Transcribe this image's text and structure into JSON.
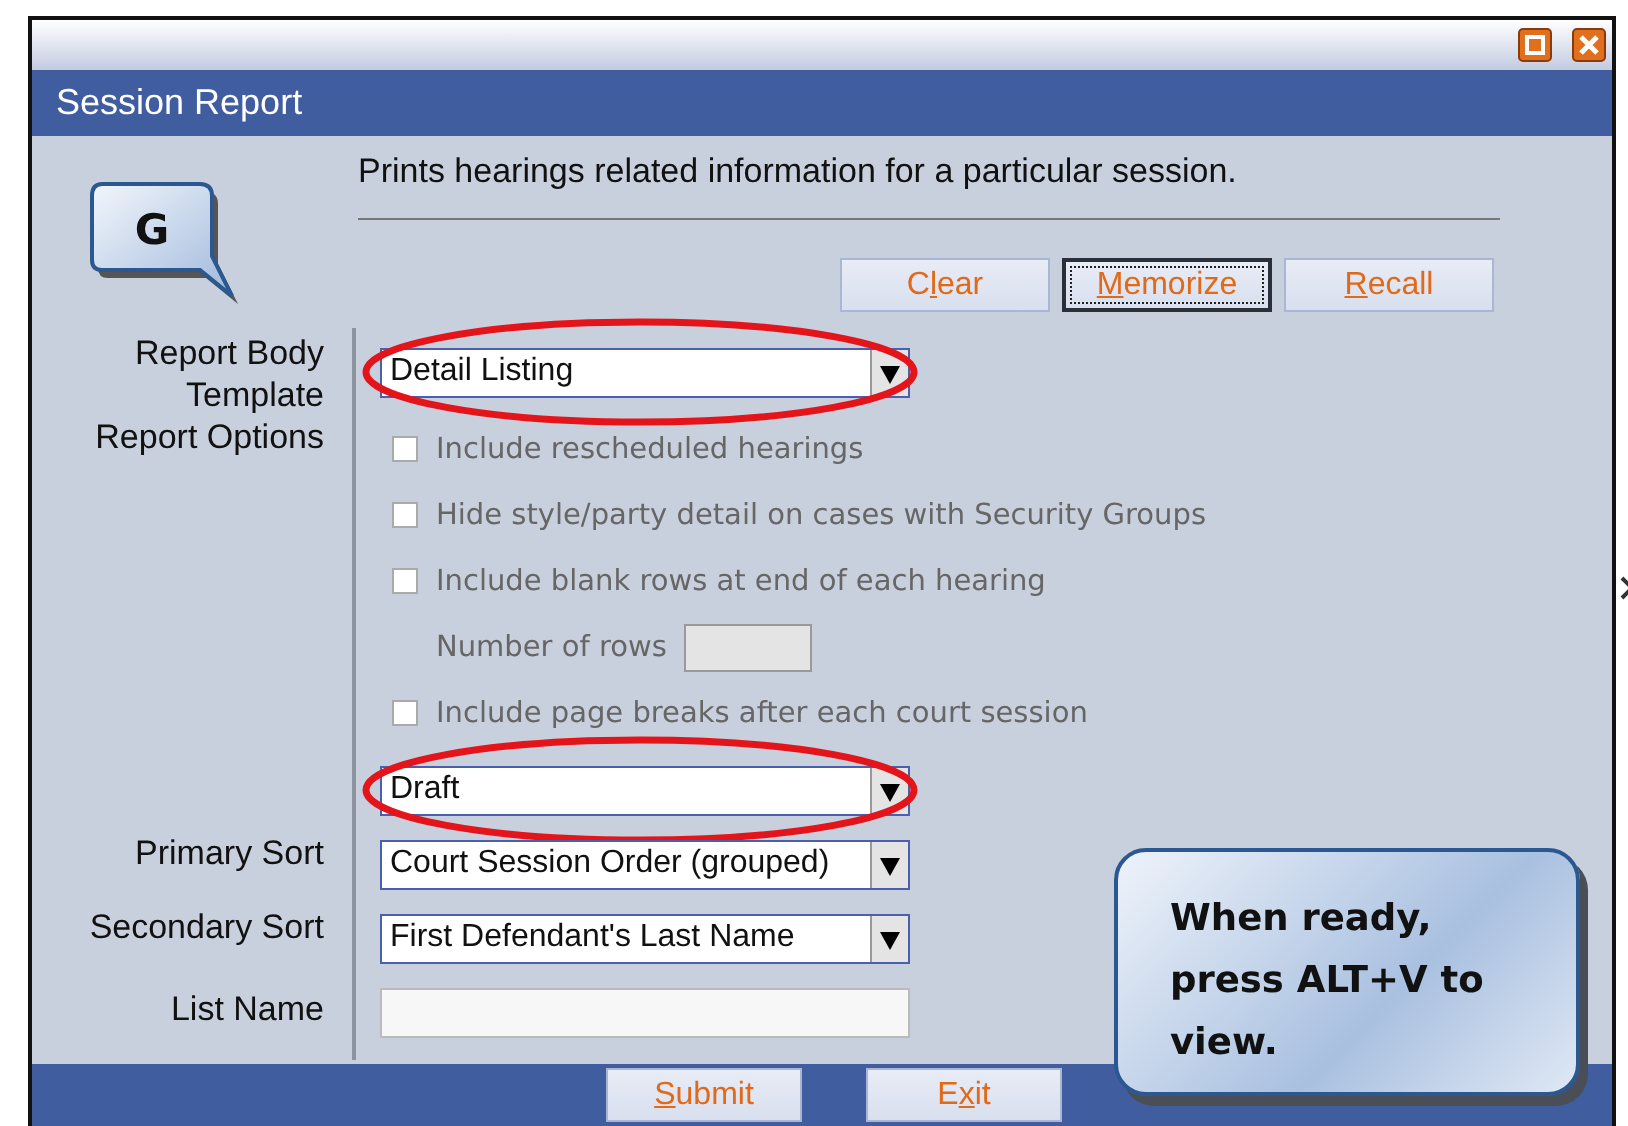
{
  "window": {
    "title": "Session Report",
    "controls": [
      {
        "kind": "maximize"
      },
      {
        "kind": "close"
      }
    ]
  },
  "step_callout": {
    "text": "G"
  },
  "description": "Prints hearings related information for a particular session.",
  "toolbar_buttons": [
    {
      "label": {
        "before": "C",
        "key": "l",
        "after": "ear"
      },
      "focused": false
    },
    {
      "label": {
        "key": "M",
        "after": "emorize"
      },
      "focused": true
    },
    {
      "label": {
        "key": "R",
        "after": "ecall"
      },
      "focused": false
    }
  ],
  "fields": [
    {
      "kind": "select",
      "label": "Report Body Template",
      "value": "Detail Listing",
      "annotated": true
    },
    {
      "kind": "options",
      "label": "Report Options",
      "options": [
        {
          "kind": "checkbox",
          "label": "Include rescheduled hearings",
          "checked": false,
          "disabled": true
        },
        {
          "kind": "checkbox",
          "label": "Hide style/party detail on cases with Security Groups",
          "checked": false,
          "disabled": true
        },
        {
          "kind": "checkbox",
          "label": "Include blank rows at end of each hearing",
          "checked": false,
          "disabled": true
        },
        {
          "kind": "number",
          "label": "Number of rows",
          "disabled": true
        },
        {
          "kind": "checkbox",
          "label": "Include page breaks after each court session",
          "checked": false,
          "disabled": true
        }
      ]
    },
    {
      "kind": "select",
      "value": "Draft",
      "annotated": true
    },
    {
      "kind": "select",
      "label": "Primary Sort",
      "value": "Court Session Order (grouped)",
      "annotated": false
    },
    {
      "kind": "select",
      "label": "Secondary Sort",
      "value": "First Defendant's Last Name",
      "annotated": false
    },
    {
      "kind": "text",
      "label": "List Name"
    }
  ],
  "footer_buttons": [
    {
      "label": {
        "key": "S",
        "after": "ubmit"
      }
    },
    {
      "label": {
        "before": "E",
        "key": "x",
        "after": "it"
      }
    }
  ],
  "note_callout": {
    "text": "When ready, press ALT+V to view."
  }
}
